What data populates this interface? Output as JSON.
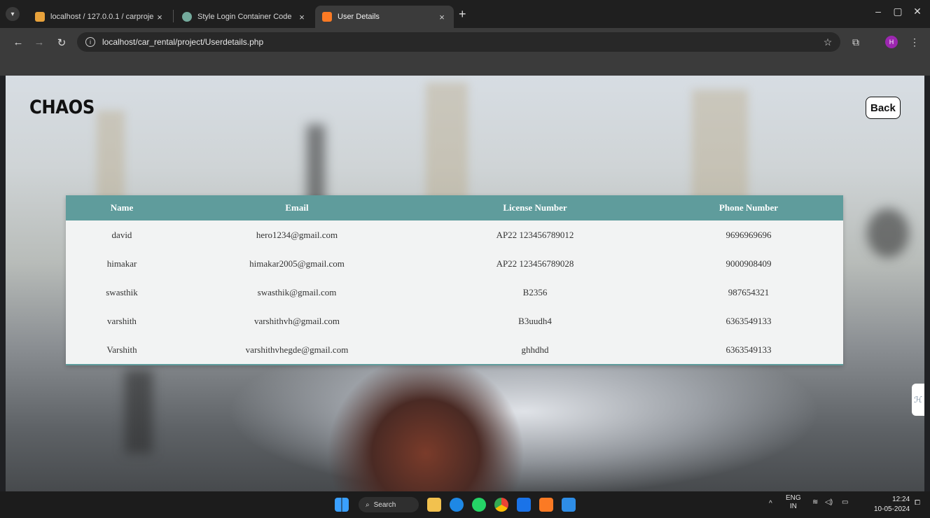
{
  "browser": {
    "tabs": [
      {
        "label": "localhost / 127.0.0.1 / carproje",
        "active": false,
        "icon": "phpmyadmin-icon"
      },
      {
        "label": "Style Login Container Code",
        "active": false,
        "icon": "chatgpt-icon"
      },
      {
        "label": "User Details",
        "active": true,
        "icon": "xampp-icon"
      }
    ],
    "url": "localhost/car_rental/project/Userdetails.php",
    "profile_initial": "H"
  },
  "page": {
    "logo": "CHAOS",
    "back_label": "Back",
    "table": {
      "headers": [
        "Name",
        "Email",
        "License Number",
        "Phone Number"
      ],
      "rows": [
        [
          "david",
          "hero1234@gmail.com",
          "AP22 123456789012",
          "9696969696"
        ],
        [
          "himakar",
          "himakar2005@gmail.com",
          "AP22 123456789028",
          "9000908409"
        ],
        [
          "swasthik",
          "swasthik@gmail.com",
          "B2356",
          "987654321"
        ],
        [
          "varshith",
          "varshithvh@gmail.com",
          "B3uudh4",
          "6363549133"
        ],
        [
          "Varshith",
          "varshithvhegde@gmail.com",
          "ghhdhd",
          "6363549133"
        ]
      ]
    },
    "header_color": "#5f9c9c"
  },
  "taskbar": {
    "search_label": "Search",
    "language_line1": "ENG",
    "language_line2": "IN",
    "time": "12:24",
    "date": "10-05-2024"
  }
}
